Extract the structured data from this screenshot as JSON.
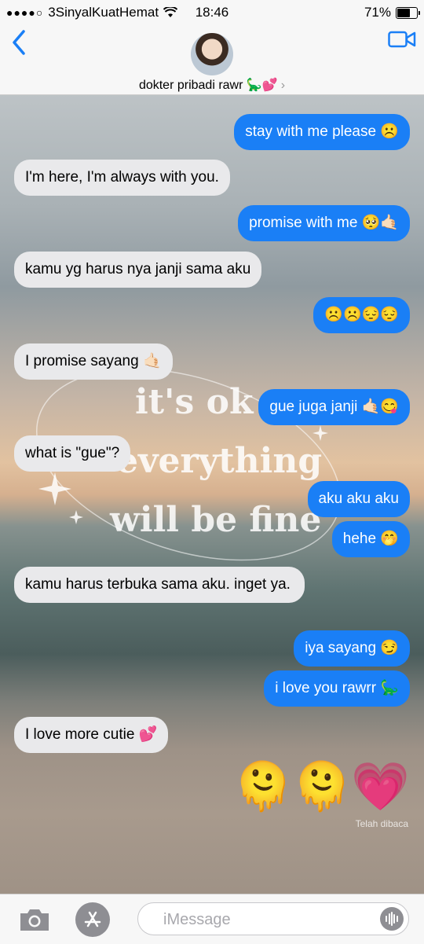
{
  "status": {
    "carrier": "3SinyalKuatHemat",
    "time": "18:46",
    "battery": "71%",
    "battery_level": 0.71
  },
  "header": {
    "contact_name": "dokter pribadi rawr 🦕💕",
    "chevron": "›"
  },
  "icons": {
    "back": "back-chevron-icon",
    "video": "facetime-video-icon",
    "camera": "camera-icon",
    "appstore": "app-store-icon",
    "audio": "audio-waveform-icon"
  },
  "messages": [
    {
      "side": "out",
      "text": "stay with me please ☹️"
    },
    {
      "side": "in",
      "text": "I'm here, I'm always with you."
    },
    {
      "side": "out",
      "text": "promise with me 🥺🤙🏻"
    },
    {
      "side": "in",
      "text": "kamu yg harus nya janji sama aku"
    },
    {
      "side": "out",
      "text": "☹️☹️😔😔"
    },
    {
      "side": "in",
      "text": "I promise sayang 🤙🏻"
    },
    {
      "side": "out",
      "text": "gue juga janji 🤙🏻😋"
    },
    {
      "side": "in",
      "text": "what is \"gue\"?"
    },
    {
      "side": "out",
      "text": "aku aku aku"
    },
    {
      "side": "out",
      "text": "hehe 🤭"
    },
    {
      "side": "in",
      "text": "kamu harus terbuka sama aku. inget ya."
    },
    {
      "side": "out",
      "text": "iya sayang 😏"
    },
    {
      "side": "out",
      "text": "i love you rawrr 🦕"
    },
    {
      "side": "in",
      "text": "I love more cutie 💕"
    }
  ],
  "big_emoji": "🫠🫠💗",
  "read_receipt": "Telah dibaca",
  "wallpaper_text": [
    "it's ok",
    "everything",
    "will be fine"
  ],
  "input": {
    "placeholder": "iMessage"
  }
}
